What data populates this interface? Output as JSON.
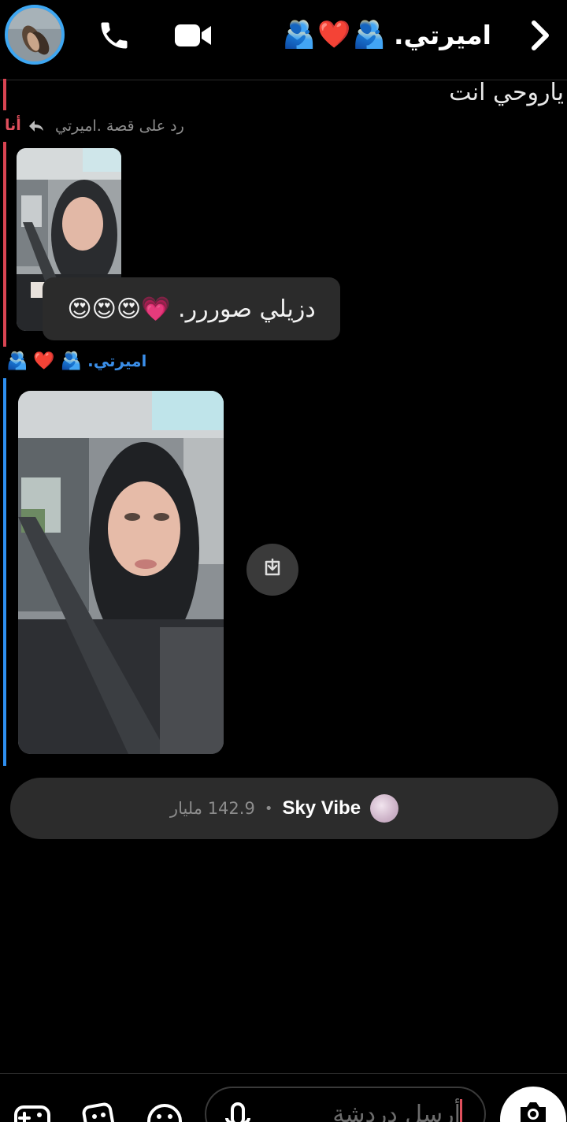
{
  "header": {
    "title_name": "اميرتي.",
    "title_emoji_1": "🫂",
    "title_emoji_2": "❤️",
    "title_emoji_3": "🫂"
  },
  "messages": {
    "top_text": "ياروحي انت",
    "me_label": "أنا",
    "reply_label": "رد على قصة .اميرتي",
    "bubble_text": "دزيلي صوررر. 💗😍😍😍",
    "sender_name": "اميرتي.",
    "sender_emoji_1": "🫂",
    "sender_emoji_2": "❤️",
    "sender_emoji_3": "🫂"
  },
  "banner": {
    "name": "Sky Vibe",
    "separator": "•",
    "count": "142.9 مليار"
  },
  "composer": {
    "placeholder": "أرسل دردشة"
  },
  "colors": {
    "accent_blue": "#3ea7f2",
    "me_red": "#e0505d",
    "sender_blue": "#3a8ee8"
  }
}
